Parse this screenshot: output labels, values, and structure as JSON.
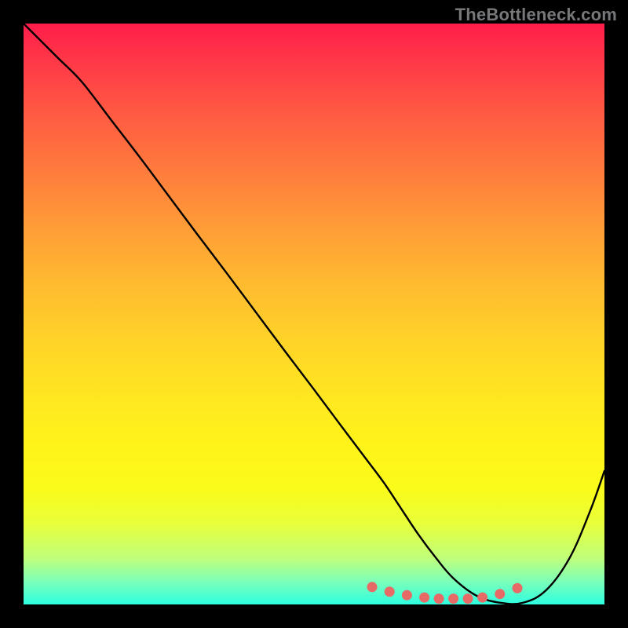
{
  "watermark": "TheBottleneck.com",
  "colors": {
    "page_bg": "#000000",
    "curve_stroke": "#000000",
    "dot_fill": "#e86a66",
    "gradient_top": "#ff1d4a",
    "gradient_bottom": "#2dffe0"
  },
  "chart_data": {
    "type": "line",
    "title": "",
    "xlabel": "",
    "ylabel": "",
    "xlim": [
      0,
      100
    ],
    "ylim": [
      0,
      100
    ],
    "grid": false,
    "legend": false,
    "series": [
      {
        "name": "bottleneck-curve",
        "x": [
          0,
          3,
          6,
          10,
          15,
          20,
          25,
          30,
          35,
          40,
          45,
          50,
          55,
          59,
          62,
          65,
          68,
          71,
          74,
          78,
          82,
          86,
          90,
          94,
          97.5,
          100
        ],
        "y": [
          100,
          97,
          94,
          90,
          83.5,
          77,
          70.3,
          63.6,
          57,
          50.3,
          43.6,
          37,
          30.3,
          25,
          21,
          16.5,
          12,
          8,
          4.5,
          1.5,
          0.3,
          0.3,
          2.5,
          8,
          16,
          23
        ]
      }
    ],
    "annotations": {
      "bottom_dots_x": [
        60,
        63,
        66,
        69,
        71.5,
        74,
        76.5,
        79,
        82,
        85
      ],
      "bottom_dots_y": [
        3.0,
        2.2,
        1.6,
        1.2,
        1.0,
        1.0,
        1.0,
        1.2,
        1.8,
        2.8
      ]
    }
  }
}
